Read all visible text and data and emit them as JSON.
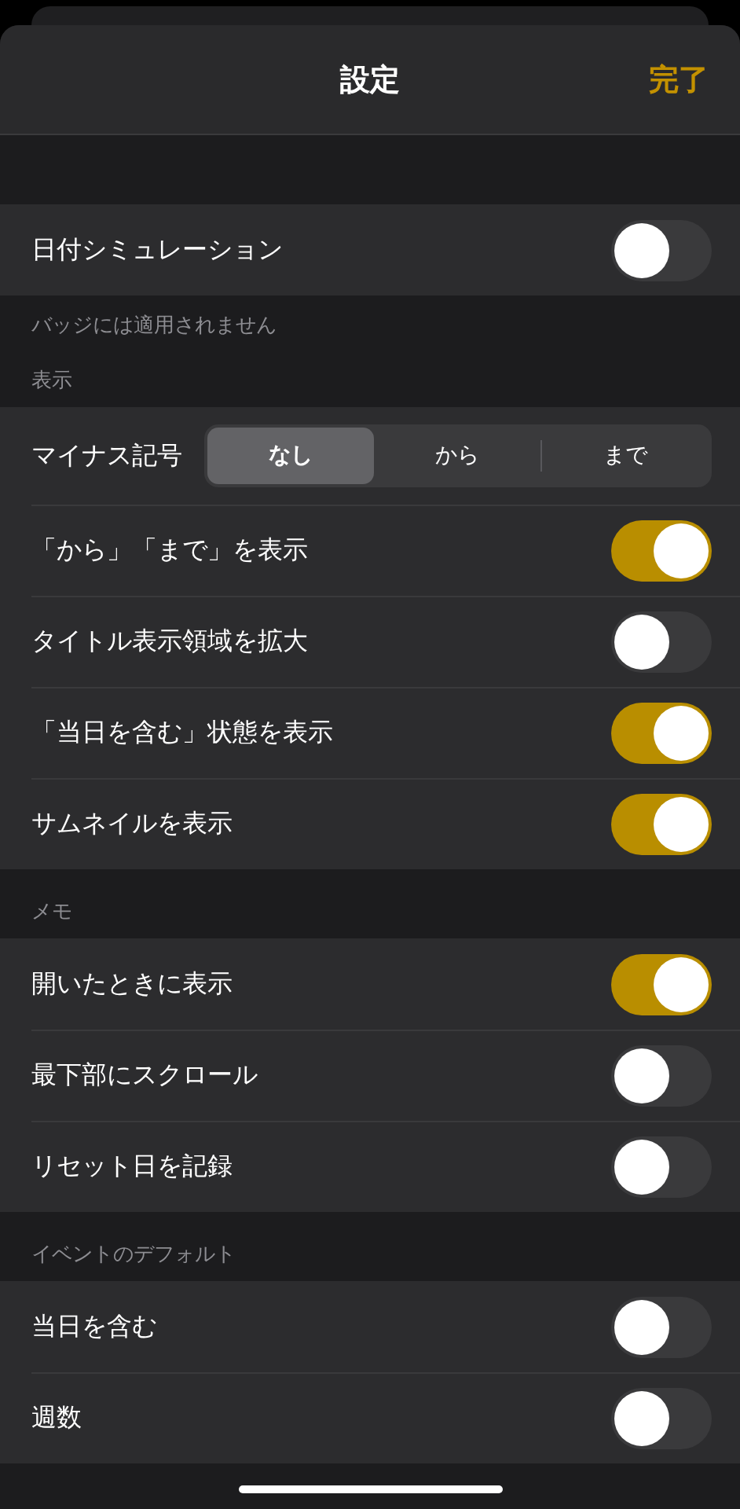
{
  "header": {
    "title": "設定",
    "done": "完了"
  },
  "sections": [
    {
      "footer": "バッジには適用されません",
      "rows": [
        {
          "kind": "toggle",
          "label": "日付シミュレーション",
          "on": false
        }
      ]
    },
    {
      "header": "表示",
      "rows": [
        {
          "kind": "segmented",
          "label": "マイナス記号",
          "options": [
            {
              "label": "なし",
              "selected": true
            },
            {
              "label": "から",
              "selected": false
            },
            {
              "label": "まで",
              "selected": false
            }
          ]
        },
        {
          "kind": "toggle",
          "label": "「から」「まで」を表示",
          "on": true
        },
        {
          "kind": "toggle",
          "label": "タイトル表示領域を拡大",
          "on": false
        },
        {
          "kind": "toggle",
          "label": "「当日を含む」状態を表示",
          "on": true
        },
        {
          "kind": "toggle",
          "label": "サムネイルを表示",
          "on": true
        }
      ]
    },
    {
      "header": "メモ",
      "rows": [
        {
          "kind": "toggle",
          "label": "開いたときに表示",
          "on": true
        },
        {
          "kind": "toggle",
          "label": "最下部にスクロール",
          "on": false
        },
        {
          "kind": "toggle",
          "label": "リセット日を記録",
          "on": false
        }
      ]
    },
    {
      "header": "イベントのデフォルト",
      "rows": [
        {
          "kind": "toggle",
          "label": "当日を含む",
          "on": false
        },
        {
          "kind": "toggle",
          "label": "週数",
          "on": false
        }
      ]
    }
  ]
}
